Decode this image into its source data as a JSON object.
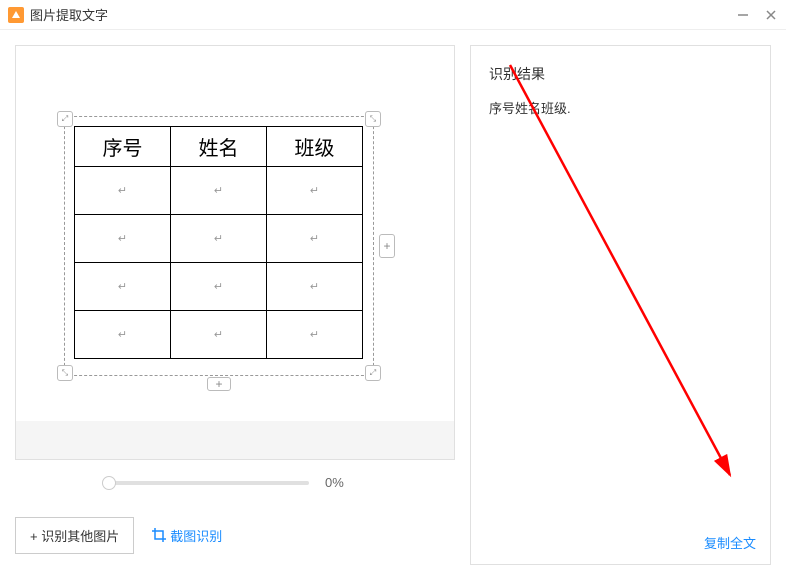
{
  "titlebar": {
    "title": "图片提取文字"
  },
  "table": {
    "headers": [
      "序号",
      "姓名",
      "班级"
    ],
    "empty_cell": "↵"
  },
  "slider": {
    "percent": "0%"
  },
  "buttons": {
    "recognize_other": "+ 识别其他图片",
    "crop_recognize": "截图识别"
  },
  "result": {
    "title": "识别结果",
    "text": "序号姓名班级.",
    "copy": "复制全文"
  }
}
